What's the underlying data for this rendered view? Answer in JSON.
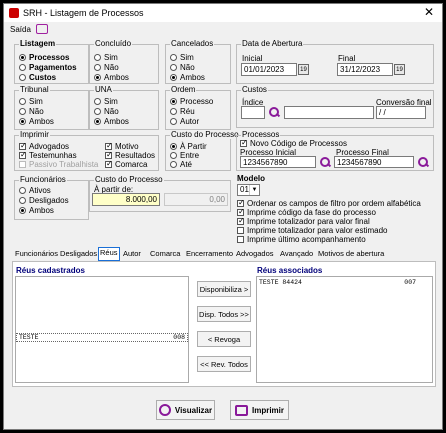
{
  "window": {
    "title": "SRH - Listagem de Processos",
    "close": "✕"
  },
  "menu": {
    "saida": "Saída"
  },
  "listagem": {
    "title": "Listagem",
    "options": [
      "Processos",
      "Pagamentos",
      "Custos"
    ],
    "selected": 0
  },
  "concluido": {
    "title": "Concluído",
    "options": [
      "Sim",
      "Não",
      "Ambos"
    ],
    "selected": 2
  },
  "cancelados": {
    "title": "Cancelados",
    "options": [
      "Sim",
      "Não",
      "Ambos"
    ],
    "selected": 2
  },
  "data_abertura": {
    "title": "Data de Abertura",
    "inicial_label": "Inicial",
    "inicial_value": "01/01/2023",
    "final_label": "Final",
    "final_value": "31/12/2023",
    "cal_icon": "19"
  },
  "tribunal": {
    "title": "Tribunal",
    "options": [
      "Sim",
      "Não",
      "Ambos"
    ],
    "selected": 2
  },
  "una": {
    "title": "UNA",
    "options": [
      "Sim",
      "Não",
      "Ambos"
    ],
    "selected": 2
  },
  "ordem": {
    "title": "Ordem",
    "options": [
      "Processo",
      "Réu",
      "Autor"
    ],
    "selected": 0
  },
  "custos": {
    "title": "Custos",
    "indice_label": "Índice",
    "conversao_label": "Conversão final",
    "conversao_value": "/ /"
  },
  "imprimir": {
    "title": "Imprimir",
    "items": [
      {
        "label": "Advogados",
        "checked": true,
        "disabled": false
      },
      {
        "label": "Testemunhas",
        "checked": true,
        "disabled": false
      },
      {
        "label": "Passivo Trabalhista",
        "checked": false,
        "disabled": true
      },
      {
        "label": "Motivo",
        "checked": true,
        "disabled": false
      },
      {
        "label": "Resultados",
        "checked": true,
        "disabled": false
      },
      {
        "label": "Comarca",
        "checked": true,
        "disabled": false
      }
    ]
  },
  "custo_processo": {
    "title": "Custo do Processo",
    "options": [
      "À Partir",
      "Entre",
      "Até"
    ],
    "selected": 0
  },
  "processos": {
    "title": "Processos",
    "novo_codigo_label": "Novo Código de Processos",
    "novo_codigo_checked": true,
    "inicial_label": "Processo Inicial",
    "inicial_value": "1234567890",
    "final_label": "Processo Final",
    "final_value": "1234567890"
  },
  "funcionarios": {
    "title": "Funcionários",
    "options": [
      "Ativos",
      "Desligados",
      "Ambos"
    ],
    "selected": 2
  },
  "custo_valor": {
    "title": "Custo do Processo",
    "a_partir_label": "À partir de:",
    "value1": "8.000,00",
    "value2": "0,00"
  },
  "modelo": {
    "title": "Modelo",
    "value": "01"
  },
  "flags": [
    {
      "label": "Ordenar os campos de filtro por ordem alfabética",
      "checked": true
    },
    {
      "label": "Imprime código da fase do processo",
      "checked": true
    },
    {
      "label": "Imprime totalizador para valor final",
      "checked": true
    },
    {
      "label": "Imprime totalizador para valor estimado",
      "checked": false
    },
    {
      "label": "Imprime último acompanhamento",
      "checked": false
    }
  ],
  "tabs": [
    "Funcionários Desligados",
    "Réus",
    "Autor",
    "Comarca",
    "Encerramento",
    "Advogados",
    "Avançado",
    "Motivos de abertura"
  ],
  "active_tab": 1,
  "reus_cadastrados": {
    "title": "Réus cadastrados",
    "rows": [
      {
        "name": "TESTE",
        "code": "008"
      }
    ]
  },
  "reus_associados": {
    "title": "Réus associados",
    "rows": [
      {
        "name": "TESTE 84424",
        "code": "007"
      }
    ]
  },
  "buttons": {
    "disponibiliza": "Disponibiliza >",
    "disp_todos": "Disp. Todos >>",
    "revoga": "< Revoga",
    "rev_todos": "<< Rev. Todos",
    "visualizar": "Visualizar",
    "imprimir": "Imprimir"
  }
}
